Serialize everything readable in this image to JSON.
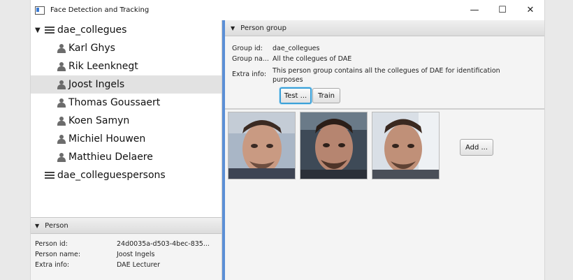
{
  "window": {
    "title": "Face Detection and Tracking",
    "minimize": "—",
    "maximize": "☐",
    "close": "✕"
  },
  "tree": {
    "groups": [
      {
        "name": "dae_collegues",
        "expanded": true,
        "persons": [
          "Karl Ghys",
          "Rik Leenknegt",
          "Joost Ingels",
          "Thomas Goussaert",
          "Koen Samyn",
          "Michiel Houwen",
          "Matthieu Delaere"
        ]
      },
      {
        "name": "dae_colleguespersons",
        "expanded": false,
        "persons": []
      }
    ],
    "selected_person": "Joost Ingels"
  },
  "person_panel": {
    "header": "Person",
    "id_label": "Person id:",
    "id_value": "24d0035a-d503-4bec-835...",
    "name_label": "Person name:",
    "name_value": "Joost Ingels",
    "extra_label": "Extra info:",
    "extra_value": "DAE Lecturer"
  },
  "group_panel": {
    "header": "Person group",
    "id_label": "Group id:",
    "id_value": "dae_collegues",
    "name_label": "Group na...",
    "name_value": "All the collegues of DAE",
    "extra_label": "Extra info:",
    "extra_value": "This person group contains all the collegues of DAE for identification purposes",
    "test_button": "Test ...",
    "train_button": "Train"
  },
  "faces": {
    "add_button": "Add ...",
    "count": 3
  },
  "colors": {
    "splitter": "#5b8fd6",
    "focus": "#3aa0d8",
    "selection": "#e2e2e2"
  }
}
